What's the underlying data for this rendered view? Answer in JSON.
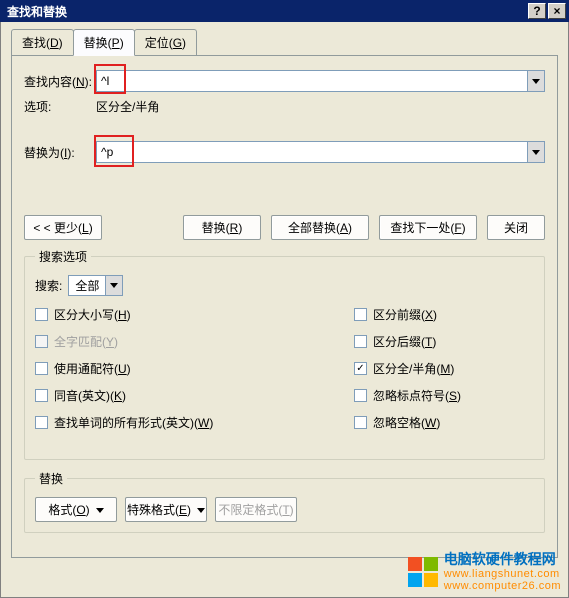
{
  "titlebar": {
    "title": "查找和替换",
    "help": "?",
    "close": "×"
  },
  "tabs": {
    "find": "查找(D)",
    "replace": "替换(P)",
    "goto": "定位(G)"
  },
  "main": {
    "findLabel": "查找内容(N):",
    "findValue": "^l",
    "optionsLabel": "选项:",
    "optionsValue": "区分全/半角",
    "replaceLabel": "替换为(I):",
    "replaceValue": "^p"
  },
  "buttons": {
    "less": "< < 更少(L)",
    "replace": "替换(R)",
    "replaceAll": "全部替换(A)",
    "findNext": "查找下一处(F)",
    "close": "关闭"
  },
  "searchOptions": {
    "legend": "搜索选项",
    "searchLabel": "搜索:",
    "scope": "全部",
    "left": {
      "matchCase": "区分大小写(H)",
      "wholeWord": "全字匹配(Y)",
      "wildcards": "使用通配符(U)",
      "soundsLike": "同音(英文)(K)",
      "wordForms": "查找单词的所有形式(英文)(W)"
    },
    "right": {
      "prefix": "区分前缀(X)",
      "suffix": "区分后缀(T)",
      "fullHalf": "区分全/半角(M)",
      "ignorePunct": "忽略标点符号(S)",
      "ignoreSpace": "忽略空格(W)"
    }
  },
  "replaceGroup": {
    "legend": "替换",
    "format": "格式(O)",
    "special": "特殊格式(E)",
    "noFormat": "不限定格式(T)"
  },
  "watermark": {
    "line1": "电脑软硬件教程网",
    "line2": "www.liangshunet.com",
    "line3": "www.computer26.com"
  }
}
